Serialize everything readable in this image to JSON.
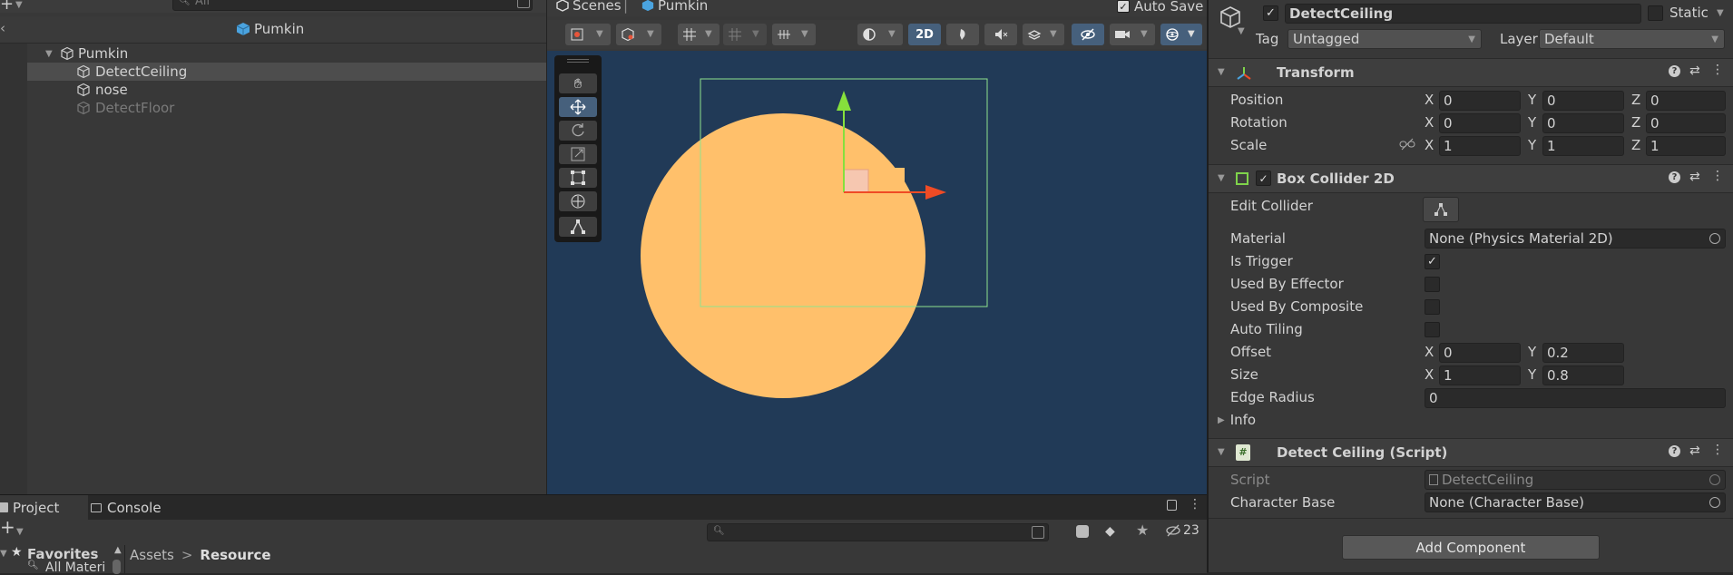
{
  "hierarchy": {
    "search_placeholder": "All",
    "scene_title": "Pumkin",
    "items": [
      {
        "label": "Pumkin"
      },
      {
        "label": "DetectCeiling"
      },
      {
        "label": "nose"
      },
      {
        "label": "DetectFloor"
      }
    ]
  },
  "scene": {
    "tab_scenes": "Scenes",
    "tab_pumkin": "Pumkin",
    "auto_save": "Auto Save",
    "mode_2d": "2D",
    "colors": {
      "background": "#213a57",
      "pumpkin": "#ffc06b",
      "collider": "#8fe38c",
      "axis_y": "#86e03c",
      "axis_x": "#ef4b25"
    }
  },
  "bottom": {
    "tab_project": "Project",
    "tab_console": "Console",
    "hidden_count": "23",
    "favorites": "Favorites",
    "all_materials": "All Materi",
    "breadcrumb_assets": "Assets",
    "breadcrumb_sep": ">",
    "breadcrumb_resource": "Resource"
  },
  "inspector": {
    "object_name": "DetectCeiling",
    "static_label": "Static",
    "tag_label": "Tag",
    "tag_value": "Untagged",
    "layer_label": "Layer",
    "layer_value": "Default",
    "transform": {
      "title": "Transform",
      "position_label": "Position",
      "rotation_label": "Rotation",
      "scale_label": "Scale",
      "x": "X",
      "y": "Y",
      "z": "Z",
      "position": [
        "0",
        "0",
        "0"
      ],
      "rotation": [
        "0",
        "0",
        "0"
      ],
      "scale": [
        "1",
        "1",
        "1"
      ]
    },
    "box_collider": {
      "title": "Box Collider 2D",
      "edit_collider": "Edit Collider",
      "material_label": "Material",
      "material_value": "None (Physics Material 2D)",
      "is_trigger_label": "Is Trigger",
      "used_by_effector_label": "Used By Effector",
      "used_by_composite_label": "Used By Composite",
      "auto_tiling_label": "Auto Tiling",
      "offset_label": "Offset",
      "offset": [
        "0",
        "0.2"
      ],
      "size_label": "Size",
      "size": [
        "1",
        "0.8"
      ],
      "edge_radius_label": "Edge Radius",
      "edge_radius": "0",
      "info_label": "Info"
    },
    "script": {
      "title": "Detect Ceiling (Script)",
      "script_label": "Script",
      "script_value": "DetectCeiling",
      "char_base_label": "Character Base",
      "char_base_value": "None (Character Base)"
    },
    "add_component": "Add Component"
  }
}
